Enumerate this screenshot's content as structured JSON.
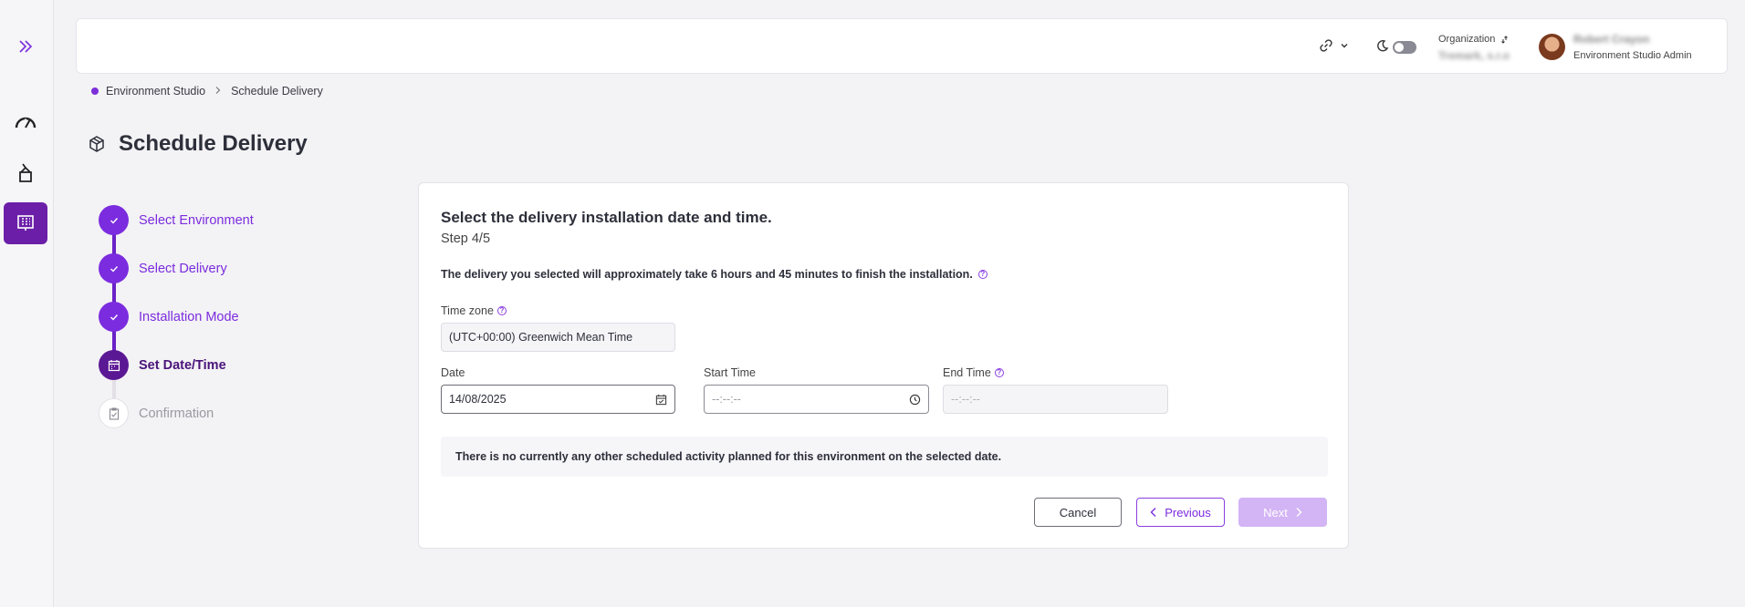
{
  "header": {
    "org_label": "Organization",
    "org_name": "Tremark, s.r.o",
    "user_name": "Robert Crayon",
    "user_role": "Environment Studio Admin"
  },
  "breadcrumb": {
    "items": [
      "Environment Studio",
      "Schedule Delivery"
    ]
  },
  "page": {
    "title": "Schedule Delivery"
  },
  "steps": [
    {
      "label": "Select Environment",
      "state": "done"
    },
    {
      "label": "Select Delivery",
      "state": "done"
    },
    {
      "label": "Installation Mode",
      "state": "done"
    },
    {
      "label": "Set Date/Time",
      "state": "current"
    },
    {
      "label": "Confirmation",
      "state": "pending"
    }
  ],
  "card": {
    "title": "Select the delivery installation  date and time.",
    "step": "Step 4/5",
    "info": "The delivery you selected will approximately take 6 hours and 45 minutes to finish the installation.",
    "help_glyph": "?",
    "timezone_label": "Time zone",
    "timezone_value": "(UTC+00:00) Greenwich Mean Time",
    "date_label": "Date",
    "date_value": "14/08/2025",
    "start_label": "Start Time",
    "start_value": "--:--:--",
    "end_label": "End Time",
    "end_value": "--:--:--",
    "notice": "There is no currently any other scheduled activity planned for this environment on the selected date.",
    "cancel": "Cancel",
    "previous": "Previous",
    "next": "Next"
  },
  "colors": {
    "accent": "#7b2cde",
    "accent_dark": "#5b1894",
    "rail_active": "#6b1fa8",
    "next_disabled": "#d3b4f5"
  }
}
